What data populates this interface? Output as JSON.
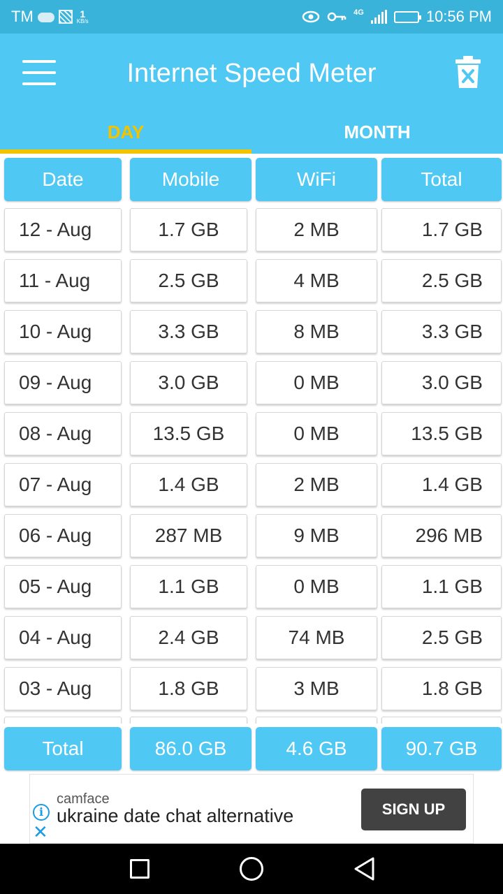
{
  "status_bar": {
    "carrier": "TM",
    "speed_value": "1",
    "speed_unit": "KB/s",
    "network": "4G",
    "time": "10:56 PM",
    "icons": [
      "cloud-icon",
      "image-icon",
      "eye-icon",
      "key-icon",
      "signal-icon",
      "battery-icon"
    ]
  },
  "app_bar": {
    "title": "Internet Speed Meter",
    "menu_icon": "hamburger-menu-icon",
    "delete_icon": "trash-icon",
    "tabs": [
      {
        "label": "DAY",
        "active": true
      },
      {
        "label": "MONTH",
        "active": false
      }
    ]
  },
  "table": {
    "headers": [
      "Date",
      "Mobile",
      "WiFi",
      "Total"
    ],
    "rows": [
      {
        "date": "12 - Aug",
        "mobile": "1.7 GB",
        "wifi": "2 MB",
        "total": "1.7 GB"
      },
      {
        "date": "11 - Aug",
        "mobile": "2.5 GB",
        "wifi": "4 MB",
        "total": "2.5 GB"
      },
      {
        "date": "10 - Aug",
        "mobile": "3.3 GB",
        "wifi": "8 MB",
        "total": "3.3 GB"
      },
      {
        "date": "09 - Aug",
        "mobile": "3.0 GB",
        "wifi": "0 MB",
        "total": "3.0 GB"
      },
      {
        "date": "08 - Aug",
        "mobile": "13.5 GB",
        "wifi": "0 MB",
        "total": "13.5 GB"
      },
      {
        "date": "07 - Aug",
        "mobile": "1.4 GB",
        "wifi": "2 MB",
        "total": "1.4 GB"
      },
      {
        "date": "06 - Aug",
        "mobile": "287 MB",
        "wifi": "9 MB",
        "total": "296 MB"
      },
      {
        "date": "05 - Aug",
        "mobile": "1.1 GB",
        "wifi": "0 MB",
        "total": "1.1 GB"
      },
      {
        "date": "04 - Aug",
        "mobile": "2.4 GB",
        "wifi": "74 MB",
        "total": "2.5 GB"
      },
      {
        "date": "03 - Aug",
        "mobile": "1.8 GB",
        "wifi": "3 MB",
        "total": "1.8 GB"
      }
    ],
    "totals": {
      "label": "Total",
      "mobile": "86.0 GB",
      "wifi": "4.6 GB",
      "total": "90.7 GB"
    }
  },
  "ad": {
    "brand": "camface",
    "text": "ukraine date chat alternative",
    "button": "SIGN UP",
    "info_icon": "info-icon",
    "close_icon": "close-icon"
  },
  "nav_bar": {
    "icons": [
      "recent-apps-icon",
      "home-icon",
      "back-icon"
    ]
  },
  "colors": {
    "app_bar": "#4fc8f4",
    "status_bar": "#3ab3da",
    "active_tab": "#f3c300",
    "ad_button": "#424242"
  }
}
